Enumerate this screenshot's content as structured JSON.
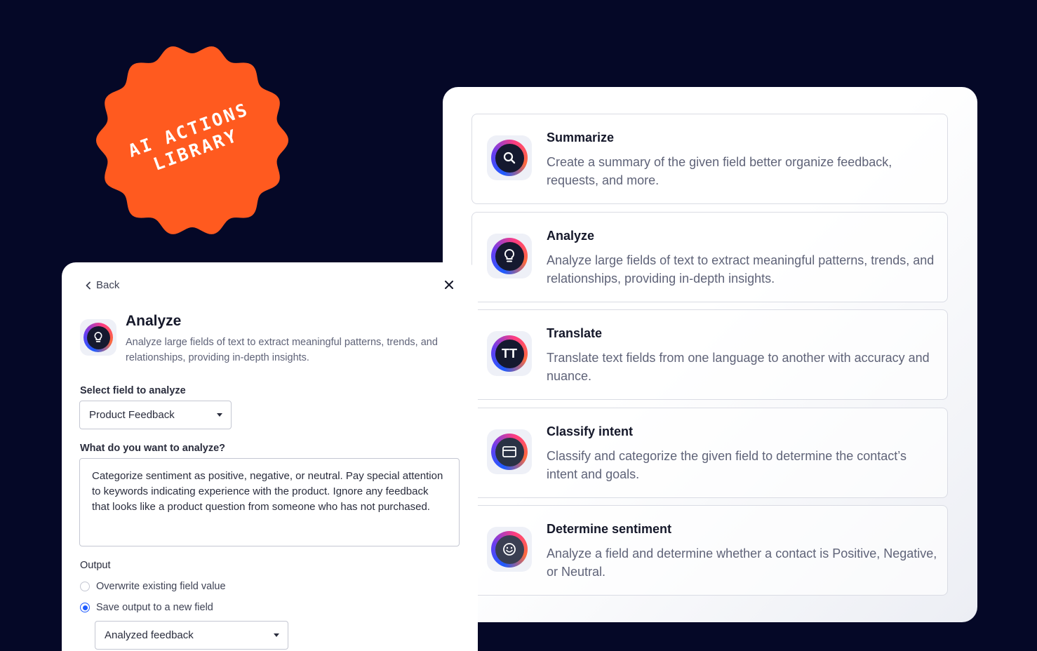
{
  "badge": {
    "line1": "AI ACTIONS",
    "line2": "LIBRARY",
    "color": "#ff5a1f"
  },
  "library": {
    "actions": [
      {
        "title": "Summarize",
        "description": "Create a summary of the given field better organize feedback, requests, and more.",
        "icon": "search-icon"
      },
      {
        "title": "Analyze",
        "description": "Analyze large fields of text to extract meaningful patterns, trends, and relationships, providing in-depth insights.",
        "icon": "lightbulb-icon"
      },
      {
        "title": "Translate",
        "description": "Translate text fields from one language to another with accuracy and nuance.",
        "icon": "translate-icon",
        "glyph": "TT"
      },
      {
        "title": "Classify intent",
        "description": "Classify and categorize the given field to determine the contact’s intent and goals.",
        "icon": "folder-icon"
      },
      {
        "title": "Determine sentiment",
        "description": "Analyze a field and determine whether a contact is Positive, Negative, or Neutral.",
        "icon": "smiley-icon"
      }
    ]
  },
  "panel": {
    "back_label": "Back",
    "title": "Analyze",
    "description": "Analyze large fields of text to extract meaningful patterns, trends, and relationships, providing in-depth insights.",
    "field_label": "Select field to analyze",
    "field_value": "Product Feedback",
    "prompt_label": "What do you want to analyze?",
    "prompt_value": "Categorize sentiment as positive, negative, or neutral. Pay special attention to keywords indicating experience with the product. Ignore any feedback that looks like a product question from someone who has not purchased.",
    "output_label": "Output",
    "output_options": [
      {
        "label": "Overwrite existing field value",
        "selected": false
      },
      {
        "label": "Save output to a new field",
        "selected": true
      }
    ],
    "new_field_value": "Analyzed feedback"
  }
}
